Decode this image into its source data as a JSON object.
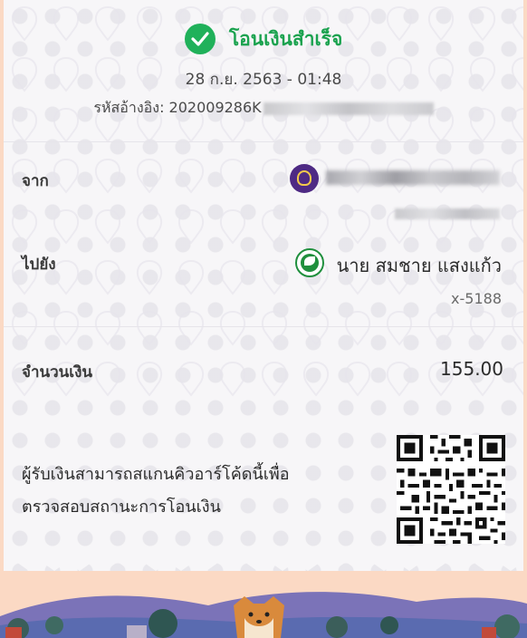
{
  "status": {
    "title": "โอนเงินสำเร็จ",
    "icon": "check-circle-icon",
    "color": "#20b15a"
  },
  "datetime": "28 ก.ย. 2563 - 01:48",
  "reference": {
    "label": "รหัสอ้างอิง:",
    "value_visible": "202009286K"
  },
  "from": {
    "label": "จาก",
    "bank_icon": "scb-bank-icon"
  },
  "to": {
    "label": "ไปยัง",
    "bank_icon": "kbank-icon",
    "name": "นาย สมชาย แสงแก้ว",
    "account": "x-5188"
  },
  "amount": {
    "label": "จำนวนเงิน",
    "value": "155.00"
  },
  "note": {
    "line1": "ผู้รับเงินสามารถสแกนคิวอาร์โค้ดนี้เพื่อ",
    "line2": "ตรวจสอบสถานะการโอนเงิน"
  },
  "colors": {
    "accent_green": "#1aa24e",
    "background_peach": "#fbd9c4",
    "card": "#f7f6f8"
  }
}
